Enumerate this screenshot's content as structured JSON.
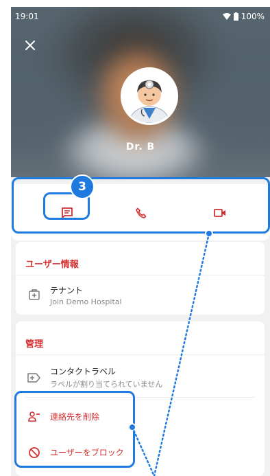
{
  "status_bar": {
    "time": "19:01",
    "battery": "100%"
  },
  "profile": {
    "name": "Dr. B"
  },
  "step_badge": "3",
  "user_info": {
    "title": "ユーザー情報",
    "tenant_label": "テナント",
    "tenant_value": "Join Demo Hospital"
  },
  "management": {
    "title": "管理",
    "contact_label_title": "コンタクトラベル",
    "contact_label_value": "ラベルが割り当てられていません",
    "delete_contact": "連絡先を削除",
    "block_user": "ユーザーをブロック"
  },
  "colors": {
    "accent": "#d32f2f",
    "highlight": "#1f7ae0"
  },
  "icons": [
    "close-icon",
    "message-icon",
    "phone-icon",
    "video-icon",
    "tenant-icon",
    "label-icon",
    "remove-contact-icon",
    "block-icon"
  ]
}
